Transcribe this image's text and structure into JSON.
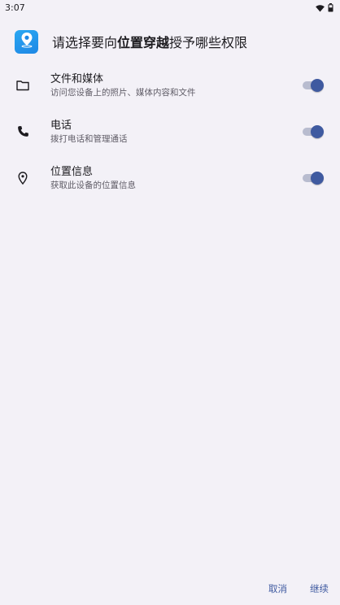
{
  "status_bar": {
    "time": "3:07",
    "wifi_icon": "wifi-icon",
    "battery_icon": "battery-icon"
  },
  "header": {
    "app_icon": "location-pin-icon",
    "title_prefix": "请选择要向",
    "app_name": "位置穿越",
    "title_suffix": "授予哪些权限"
  },
  "permissions": [
    {
      "icon": "folder-icon",
      "title": "文件和媒体",
      "description": "访问您设备上的照片、媒体内容和文件",
      "enabled": true
    },
    {
      "icon": "phone-icon",
      "title": "电话",
      "description": "拨打电话和管理通话",
      "enabled": true
    },
    {
      "icon": "location-icon",
      "title": "位置信息",
      "description": "获取此设备的位置信息",
      "enabled": true
    }
  ],
  "footer": {
    "cancel_label": "取消",
    "continue_label": "继续"
  },
  "colors": {
    "accent": "#3f5aa0",
    "track": "#b8bccf",
    "background": "#f3f1f7"
  }
}
